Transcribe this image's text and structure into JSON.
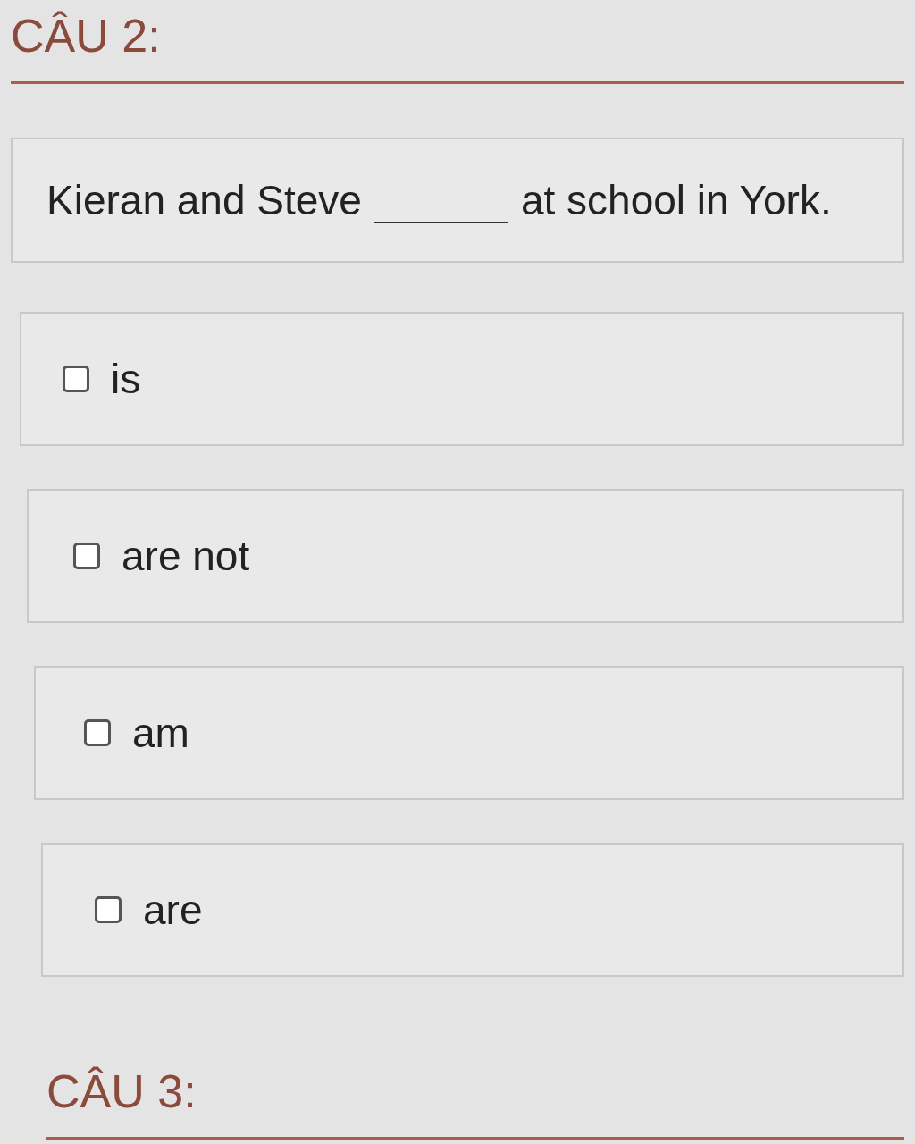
{
  "sections": [
    {
      "heading": "CÂU 2:",
      "question": {
        "before": "Kieran and Steve",
        "after": "at school in York."
      },
      "options": [
        {
          "label": "is",
          "checked": false
        },
        {
          "label": "are not",
          "checked": false
        },
        {
          "label": "am",
          "checked": false
        },
        {
          "label": "are",
          "checked": false
        }
      ]
    },
    {
      "heading": "CÂU 3:"
    }
  ]
}
